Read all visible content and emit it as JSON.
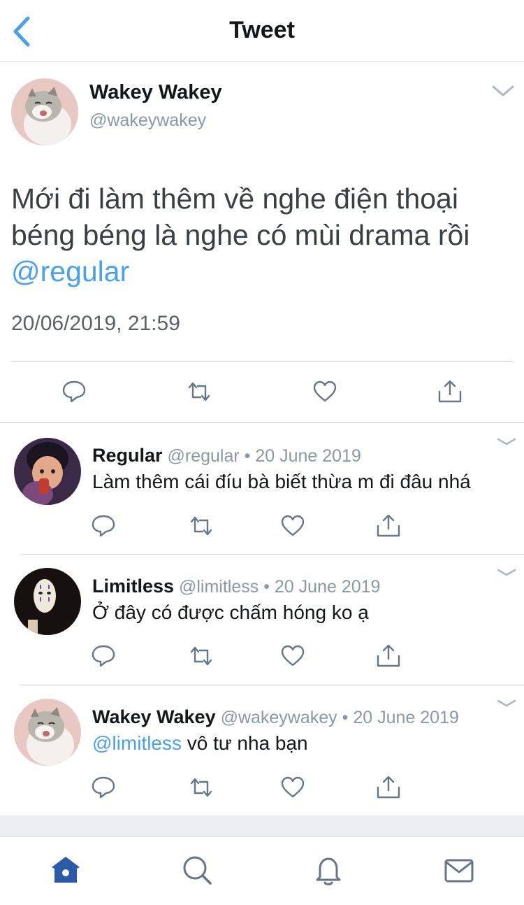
{
  "nav": {
    "title": "Tweet",
    "back_icon": "chevron-left-icon"
  },
  "tweet": {
    "name": "Wakey Wakey",
    "handle": "@wakeywakey",
    "text": "Mới đi làm thêm về nghe điện thoại béng béng là nghe có mùi drama rồi ",
    "mention": "@regular",
    "timestamp": "20/06/2019, 21:59"
  },
  "replies": [
    {
      "name": "Regular",
      "handle": "@regular",
      "date": "• 20 June 2019",
      "mention": "",
      "text": "Làm thêm cái đíu bà biết thừa m đi đâu nhá"
    },
    {
      "name": "Limitless",
      "handle": "@limitless",
      "date": "• 20 June 2019",
      "mention": "",
      "text": "Ở đây có được chấm hóng ko ạ"
    },
    {
      "name": "Wakey Wakey",
      "handle": "@wakeywakey",
      "date": "• 20 June 2019",
      "mention": "@limitless",
      "text": " vô tư nha bạn"
    }
  ],
  "tabs": [
    "home-icon",
    "search-icon",
    "notifications-icon",
    "messages-icon"
  ],
  "colors": {
    "accent": "#1da1f2",
    "mention": "#4aa1eb",
    "tab_active": "#2a5aa8",
    "icon_gray": "#657786"
  }
}
